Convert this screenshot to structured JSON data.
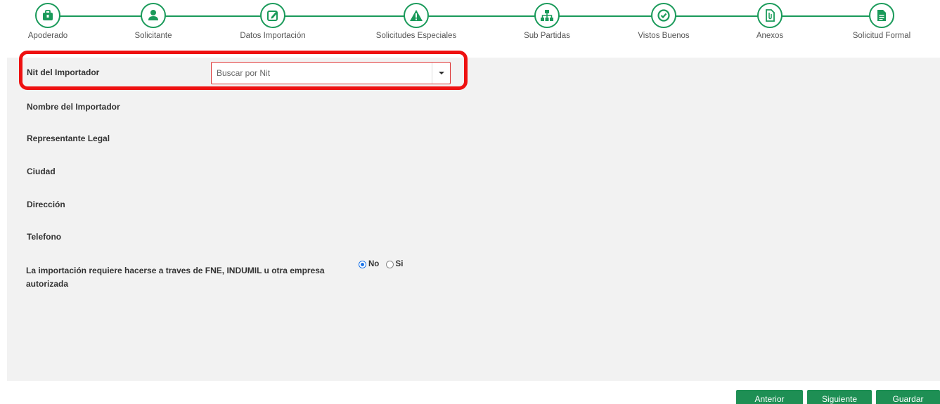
{
  "stepper": {
    "steps": [
      {
        "label": "Apoderado",
        "icon": "briefcase-icon"
      },
      {
        "label": "Solicitante",
        "icon": "user-icon"
      },
      {
        "label": "Datos Importación",
        "icon": "edit-icon"
      },
      {
        "label": "Solicitudes Especiales",
        "icon": "warning-icon"
      },
      {
        "label": "Sub Partidas",
        "icon": "sitemap-icon"
      },
      {
        "label": "Vistos Buenos",
        "icon": "check-circle-icon"
      },
      {
        "label": "Anexos",
        "icon": "attachment-icon"
      },
      {
        "label": "Solicitud Formal",
        "icon": "document-icon"
      }
    ],
    "accent_color": "#1a9a5a"
  },
  "form": {
    "nit_label": "Nit del Importador",
    "nit_placeholder": "Buscar por Nit",
    "nombre_label": "Nombre del Importador",
    "representante_label": "Representante Legal",
    "ciudad_label": "Ciudad",
    "direccion_label": "Dirección",
    "telefono_label": "Telefono",
    "question_label": "La importación requiere hacerse a traves de FNE, INDUMIL u otra empresa autorizada",
    "radio_no": "No",
    "radio_si": "Si",
    "selected": "No",
    "highlight_color": "#ee1111"
  },
  "buttons": {
    "anterior": "Anterior",
    "siguiente": "Siguiente",
    "guardar": "Guardar",
    "color": "#1e8f54"
  }
}
